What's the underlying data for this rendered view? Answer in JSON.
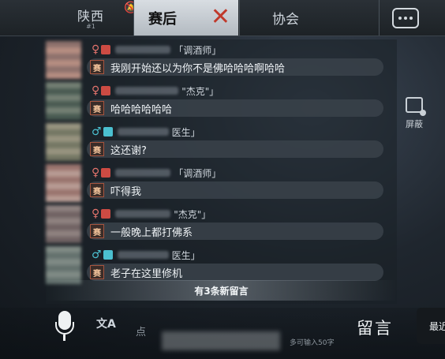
{
  "header": {
    "tab_province": "陕西",
    "tab_province_rank": "#1",
    "tab_match": "赛后",
    "tab_association": "协会"
  },
  "messages": [
    {
      "gender": "♀",
      "role_tag": "「调酒师」",
      "badge": "赛",
      "text": "我刚开始还以为你不是佛哈哈哈啊哈哈"
    },
    {
      "gender": "♀",
      "role_tag": "\"杰克\"」",
      "badge": "赛",
      "text": "哈哈哈哈哈哈"
    },
    {
      "gender": "♂",
      "role_tag": "医生」",
      "badge": "赛",
      "text": "这还谢?"
    },
    {
      "gender": "♀",
      "role_tag": "「调酒师」",
      "badge": "赛",
      "text": "吓得我"
    },
    {
      "gender": "♀",
      "role_tag": "\"杰克\"」",
      "badge": "赛",
      "text": "一般晚上都打佛系"
    },
    {
      "gender": "♂",
      "role_tag": "医生」",
      "badge": "赛",
      "text": "老子在这里修机"
    }
  ],
  "new_messages_notice": "有3条新留言",
  "side": {
    "block_label": "屏蔽"
  },
  "bottom": {
    "input_placeholder": "点",
    "input_limit": "多可输入50字",
    "post_label": "留言",
    "latest_label": "最近"
  }
}
